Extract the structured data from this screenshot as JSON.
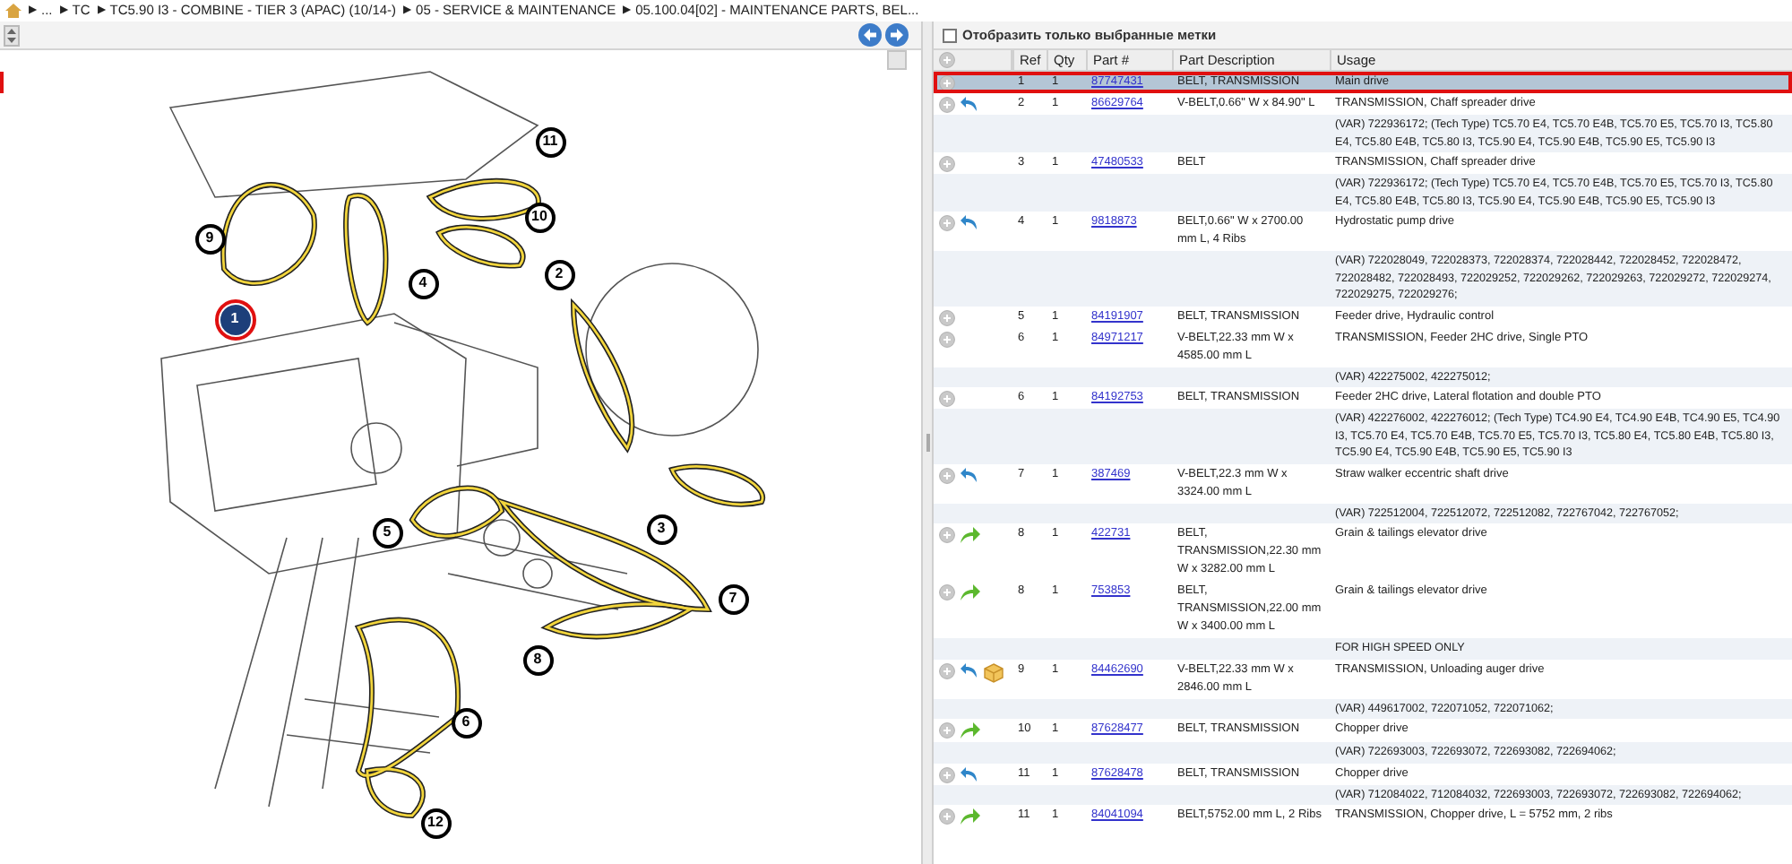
{
  "breadcrumb": {
    "separator": "▶",
    "items": [
      "...",
      "TC",
      "TC5.90 I3 - COMBINE - TIER 3 (APAC) (10/14-)",
      "05 - SERVICE & MAINTENANCE",
      "05.100.04[02] - MAINTENANCE PARTS, BEL..."
    ]
  },
  "diagram": {
    "callouts": [
      {
        "label": "11",
        "selected": false
      },
      {
        "label": "10",
        "selected": false
      },
      {
        "label": "9",
        "selected": false
      },
      {
        "label": "4",
        "selected": false
      },
      {
        "label": "2",
        "selected": false
      },
      {
        "label": "1",
        "selected": true
      },
      {
        "label": "3",
        "selected": false
      },
      {
        "label": "5",
        "selected": false
      },
      {
        "label": "7",
        "selected": false
      },
      {
        "label": "8",
        "selected": false
      },
      {
        "label": "6",
        "selected": false
      },
      {
        "label": "12",
        "selected": false
      }
    ]
  },
  "filter": {
    "label": "Отобразить только выбранные метки",
    "checked": false
  },
  "table": {
    "columns": [
      "Ref",
      "Qty",
      "Part #",
      "Part Description",
      "Usage"
    ],
    "rows": [
      {
        "ref": "1",
        "qty": "1",
        "part": "87747431",
        "description": "BELT, TRANSMISSION",
        "usage": "Main drive",
        "icons": [],
        "selected": true,
        "notes": []
      },
      {
        "ref": "2",
        "qty": "1",
        "part": "86629764",
        "description": "V-BELT,0.66\" W x 84.90\" L",
        "usage": "TRANSMISSION, Chaff spreader drive",
        "icons": [
          {
            "kind": "blue-arrow"
          }
        ],
        "selected": false,
        "notes": [
          "(VAR) 722936172; (Tech Type) TC5.70 E4, TC5.70 E4B, TC5.70 E5, TC5.70 I3, TC5.80 E4, TC5.80 E4B, TC5.80 I3, TC5.90 E4, TC5.90 E4B, TC5.90 E5, TC5.90 I3"
        ]
      },
      {
        "ref": "3",
        "qty": "1",
        "part": "47480533",
        "description": "BELT",
        "usage": "TRANSMISSION, Chaff spreader drive",
        "icons": [],
        "selected": false,
        "notes": [
          "(VAR) 722936172; (Tech Type) TC5.70 E4, TC5.70 E4B, TC5.70 E5, TC5.70 I3, TC5.80 E4, TC5.80 E4B, TC5.80 I3, TC5.90 E4, TC5.90 E4B, TC5.90 E5, TC5.90 I3"
        ]
      },
      {
        "ref": "4",
        "qty": "1",
        "part": "9818873",
        "description": "BELT,0.66\" W x 2700.00 mm L, 4 Ribs",
        "usage": "Hydrostatic pump drive",
        "icons": [
          {
            "kind": "blue-arrow"
          }
        ],
        "selected": false,
        "notes": [
          "(VAR) 722028049, 722028373, 722028374, 722028442, 722028452, 722028472, 722028482, 722028493, 722029252, 722029262, 722029263, 722029272, 722029274, 722029275, 722029276;"
        ]
      },
      {
        "ref": "5",
        "qty": "1",
        "part": "84191907",
        "description": "BELT, TRANSMISSION",
        "usage": "Feeder drive, Hydraulic control",
        "icons": [],
        "selected": false,
        "notes": []
      },
      {
        "ref": "6",
        "qty": "1",
        "part": "84971217",
        "description": "V-BELT,22.33 mm W x 4585.00 mm L",
        "usage": "TRANSMISSION, Feeder 2HC drive, Single PTO",
        "icons": [],
        "selected": false,
        "notes": [
          "(VAR) 422275002, 422275012;"
        ]
      },
      {
        "ref": "6",
        "qty": "1",
        "part": "84192753",
        "description": "BELT, TRANSMISSION",
        "usage": "Feeder 2HC drive, Lateral flotation and double PTO",
        "icons": [],
        "selected": false,
        "notes": [
          "(VAR) 422276002, 422276012; (Tech Type) TC4.90 E4, TC4.90 E4B, TC4.90 E5, TC4.90 I3, TC5.70 E4, TC5.70 E4B, TC5.70 E5, TC5.70 I3, TC5.80 E4, TC5.80 E4B, TC5.80 I3, TC5.90 E4, TC5.90 E4B, TC5.90 E5, TC5.90 I3"
        ]
      },
      {
        "ref": "7",
        "qty": "1",
        "part": "387469",
        "description": "V-BELT,22.3 mm W x 3324.00 mm L",
        "usage": "Straw walker eccentric shaft drive",
        "icons": [
          {
            "kind": "blue-arrow"
          }
        ],
        "selected": false,
        "notes": [
          "(VAR) 722512004, 722512072, 722512082, 722767042, 722767052;"
        ]
      },
      {
        "ref": "8",
        "qty": "1",
        "part": "422731",
        "description": "BELT, TRANSMISSION,22.30 mm W x 3282.00 mm L",
        "usage": "Grain & tailings elevator drive",
        "icons": [
          {
            "kind": "green-arrow"
          }
        ],
        "selected": false,
        "notes": []
      },
      {
        "ref": "8",
        "qty": "1",
        "part": "753853",
        "description": "BELT, TRANSMISSION,22.00 mm W x 3400.00 mm L",
        "usage": "Grain & tailings elevator drive",
        "icons": [
          {
            "kind": "green-arrow"
          }
        ],
        "selected": false,
        "notes": [
          "FOR HIGH SPEED ONLY"
        ]
      },
      {
        "ref": "9",
        "qty": "1",
        "part": "84462690",
        "description": "V-BELT,22.33 mm W x 2846.00 mm L",
        "usage": "TRANSMISSION, Unloading auger drive",
        "icons": [
          {
            "kind": "blue-arrow"
          },
          {
            "kind": "package"
          }
        ],
        "selected": false,
        "notes": [
          "(VAR) 449617002, 722071052, 722071062;"
        ]
      },
      {
        "ref": "10",
        "qty": "1",
        "part": "87628477",
        "description": "BELT, TRANSMISSION",
        "usage": "Chopper drive",
        "icons": [
          {
            "kind": "green-arrow"
          }
        ],
        "selected": false,
        "notes": [
          "(VAR) 722693003, 722693072, 722693082, 722694062;"
        ]
      },
      {
        "ref": "11",
        "qty": "1",
        "part": "87628478",
        "description": "BELT, TRANSMISSION",
        "usage": "Chopper drive",
        "icons": [
          {
            "kind": "blue-arrow"
          }
        ],
        "selected": false,
        "notes": [
          "(VAR) 712084022, 712084032, 722693003, 722693072, 722693082, 722694062;"
        ]
      },
      {
        "ref": "11",
        "qty": "1",
        "part": "84041094",
        "description": "BELT,5752.00 mm L, 2 Ribs",
        "usage": "TRANSMISSION, Chopper drive, L = 5752 mm, 2 ribs",
        "icons": [
          {
            "kind": "green-arrow"
          }
        ],
        "selected": false,
        "notes": []
      }
    ]
  }
}
